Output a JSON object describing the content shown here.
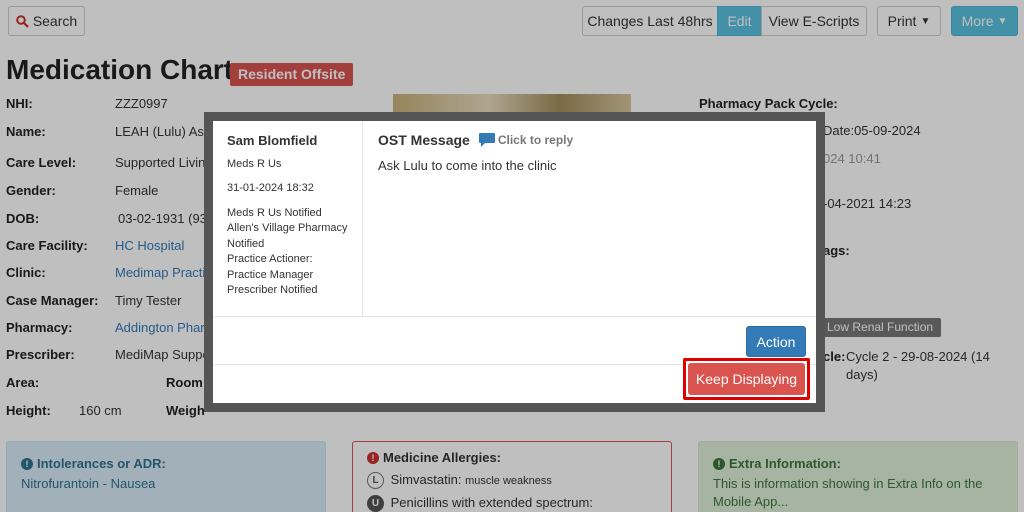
{
  "toolbar": {
    "search_label": "Search",
    "changes_label": "Changes Last 48hrs",
    "edit_label": "Edit",
    "view_escripts_label": "View E-Scripts",
    "print_label": "Print",
    "more_label": "More"
  },
  "page": {
    "title": "Medication Chart",
    "offsite_badge": "Resident Offsite"
  },
  "resident": {
    "nhi_label": "NHI:",
    "nhi": "ZZZ0997",
    "name_label": "Name:",
    "name": "LEAH (Lulu) Ash",
    "care_level_label": "Care Level:",
    "care_level": "Supported Livin",
    "gender_label": "Gender:",
    "gender": "Female",
    "dob_label": "DOB:",
    "dob": "03-02-1931 (93",
    "care_facility_label": "Care Facility:",
    "care_facility": "HC Hospital",
    "clinic_label": "Clinic:",
    "clinic": "Medimap Practi",
    "case_manager_label": "Case Manager:",
    "case_manager": "Timy Tester",
    "pharmacy_label": "Pharmacy:",
    "pharmacy": "Addington Phar",
    "prescriber_label": "Prescriber:",
    "prescriber": "MediMap Suppo",
    "area_label": "Area:",
    "room_label": "Room",
    "height_label": "Height:",
    "height": "160 cm",
    "weight_label": "Weigh"
  },
  "right_info": {
    "pharmacy_pack_cycle_label": "Pharmacy Pack Cycle:",
    "date_fragment": "Date:05-09-2024",
    "time_fragment": "024 10:41",
    "date2_fragment": "-04-2021 14:23",
    "tags_fragment": "ags:",
    "low_renal": "Low Renal Function",
    "cycle_label_fragment": "cle:",
    "cycle_value": "Cycle 2 - 29-08-2024 (14",
    "cycle_value2": "days)"
  },
  "panels": {
    "intolerances_title": "Intolerances or ADR:",
    "intolerances_value": "Nitrofurantoin - Nausea",
    "allergies_title": "Medicine Allergies:",
    "allergy1_tag": "L",
    "allergy1_name": "Simvastatin:",
    "allergy1_reaction": "muscle weakness",
    "allergy2_tag": "U",
    "allergy2_name": "Penicillins with extended spectrum:",
    "extra_title": "Extra Information:",
    "extra_line1": "This is information showing in Extra Info on the",
    "extra_line2": "Mobile App..."
  },
  "modal": {
    "sender": "Sam Blomfield",
    "org": "Meds R Us",
    "datetime": "31-01-2024 18:32",
    "notify1": "Meds R Us Notified",
    "notify2": "Allen's Village Pharmacy",
    "notify3": "Notified",
    "notify4": "Practice Actioner:",
    "notify5": "Practice Manager",
    "notify6": "Prescriber Notified",
    "message_title": "OST Message",
    "click_to_reply": "Click to reply",
    "message_body": "Ask Lulu to come into the clinic",
    "action_label": "Action",
    "keep_label": "Keep Displaying"
  }
}
